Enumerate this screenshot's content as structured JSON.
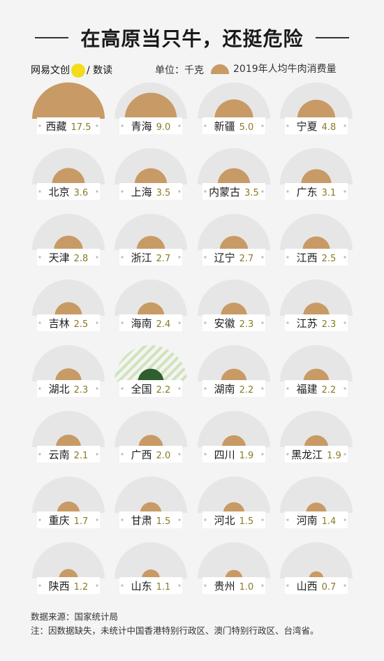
{
  "header": {
    "title": "在高原当只牛，还挺危险",
    "brand_left": "网易文创",
    "brand_badge": "Netfoon",
    "brand_right": "/ 数读",
    "unit": "单位：千克",
    "legend_label": "2019年人均牛肉消费量"
  },
  "colors": {
    "beef": "#c89a65",
    "national": "#2f5f2e",
    "national_hatch": "#cfe3b9",
    "value_text": "#8a7a26",
    "max_semicircle": "#e6e6e6"
  },
  "chart_data": {
    "type": "semicircle-proportional",
    "title": "在高原当只牛，还挺危险",
    "unit": "千克",
    "series_name": "2019年人均牛肉消费量",
    "max_value": 17.5,
    "regions": [
      {
        "name": "西藏",
        "value": 17.5
      },
      {
        "name": "青海",
        "value": 9.0
      },
      {
        "name": "新疆",
        "value": 5.0
      },
      {
        "name": "宁夏",
        "value": 4.8
      },
      {
        "name": "北京",
        "value": 3.6
      },
      {
        "name": "上海",
        "value": 3.5
      },
      {
        "name": "内蒙古",
        "value": 3.5
      },
      {
        "name": "广东",
        "value": 3.1
      },
      {
        "name": "天津",
        "value": 2.8
      },
      {
        "name": "浙江",
        "value": 2.7
      },
      {
        "name": "辽宁",
        "value": 2.7
      },
      {
        "name": "江西",
        "value": 2.5
      },
      {
        "name": "吉林",
        "value": 2.5
      },
      {
        "name": "海南",
        "value": 2.4
      },
      {
        "name": "安徽",
        "value": 2.3
      },
      {
        "name": "江苏",
        "value": 2.3
      },
      {
        "name": "湖北",
        "value": 2.3
      },
      {
        "name": "全国",
        "value": 2.2,
        "national": true
      },
      {
        "name": "湖南",
        "value": 2.2
      },
      {
        "name": "福建",
        "value": 2.2
      },
      {
        "name": "云南",
        "value": 2.1
      },
      {
        "name": "广西",
        "value": 2.0
      },
      {
        "name": "四川",
        "value": 1.9
      },
      {
        "name": "黑龙江",
        "value": 1.9
      },
      {
        "name": "重庆",
        "value": 1.7
      },
      {
        "name": "甘肃",
        "value": 1.5
      },
      {
        "name": "河北",
        "value": 1.5
      },
      {
        "name": "河南",
        "value": 1.4
      },
      {
        "name": "陕西",
        "value": 1.2
      },
      {
        "name": "山东",
        "value": 1.1
      },
      {
        "name": "贵州",
        "value": 1.0
      },
      {
        "name": "山西",
        "value": 0.7
      }
    ]
  },
  "footer": {
    "source": "数据来源：国家统计局",
    "note": "注：因数据缺失，未统计中国香港特别行政区、澳门特别行政区、台湾省。"
  }
}
